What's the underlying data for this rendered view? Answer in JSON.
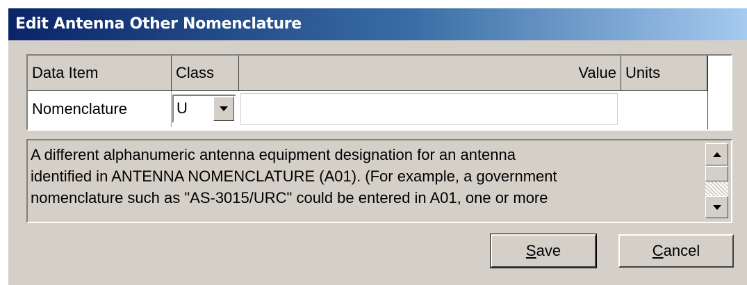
{
  "window": {
    "title": "Edit Antenna Other Nomenclature"
  },
  "table": {
    "headers": {
      "data_item": "Data Item",
      "class": "Class",
      "value": "Value",
      "units": "Units"
    },
    "row": {
      "data_item": "Nomenclature",
      "class_selected": "U",
      "value": "",
      "units": ""
    }
  },
  "description": {
    "lines": [
      "A different alphanumeric antenna equipment designation for an antenna",
      "identified in ANTENNA NOMENCLATURE (A01). (For example, a government",
      "nomenclature such as \"AS-3015/URC\" could be entered in A01, one or more"
    ]
  },
  "buttons": {
    "save": {
      "mnemonic": "S",
      "rest": "ave"
    },
    "cancel": {
      "mnemonic": "C",
      "rest": "ancel"
    }
  },
  "icons": {
    "combo": "chevron-down-icon",
    "scroll_up": "arrow-up-icon",
    "scroll_down": "arrow-down-icon"
  }
}
